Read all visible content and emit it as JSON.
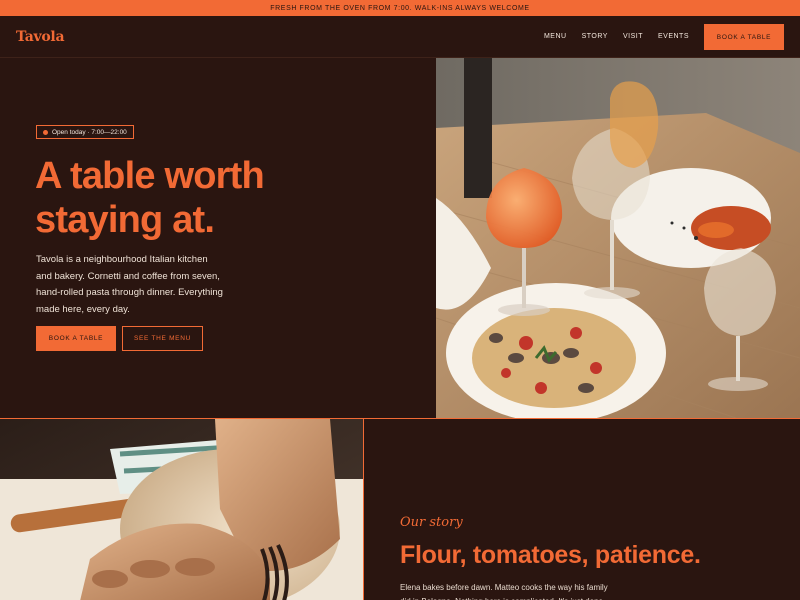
{
  "announcement": "FRESH FROM THE OVEN FROM 7:00. WALK-INS ALWAYS WELCOME",
  "brand": "Tavola",
  "nav": {
    "links": [
      "MENU",
      "STORY",
      "VISIT",
      "EVENTS"
    ],
    "cta": "BOOK A TABLE"
  },
  "hero": {
    "badge": "Open today · 7:00—22:00",
    "title_line1": "A table worth",
    "title_line2": "staying at.",
    "description": "Tavola is a neighbourhood Italian kitchen and bakery. Cornetti and coffee from seven, hand-rolled pasta through dinner. Everything made here, every day.",
    "primary_cta": "BOOK A TABLE",
    "secondary_cta": "SEE THE MENU"
  },
  "story": {
    "eyebrow": "Our story",
    "title": "Flour, tomatoes, patience.",
    "body": "Elena bakes before dawn. Matteo cooks the way his family did in Bologna. Nothing here is complicated. It's just done"
  },
  "colors": {
    "background": "#2a1510",
    "accent": "#f26a35",
    "text": "#f2e6dc"
  },
  "icons": {
    "badge": "status-dot-icon"
  }
}
